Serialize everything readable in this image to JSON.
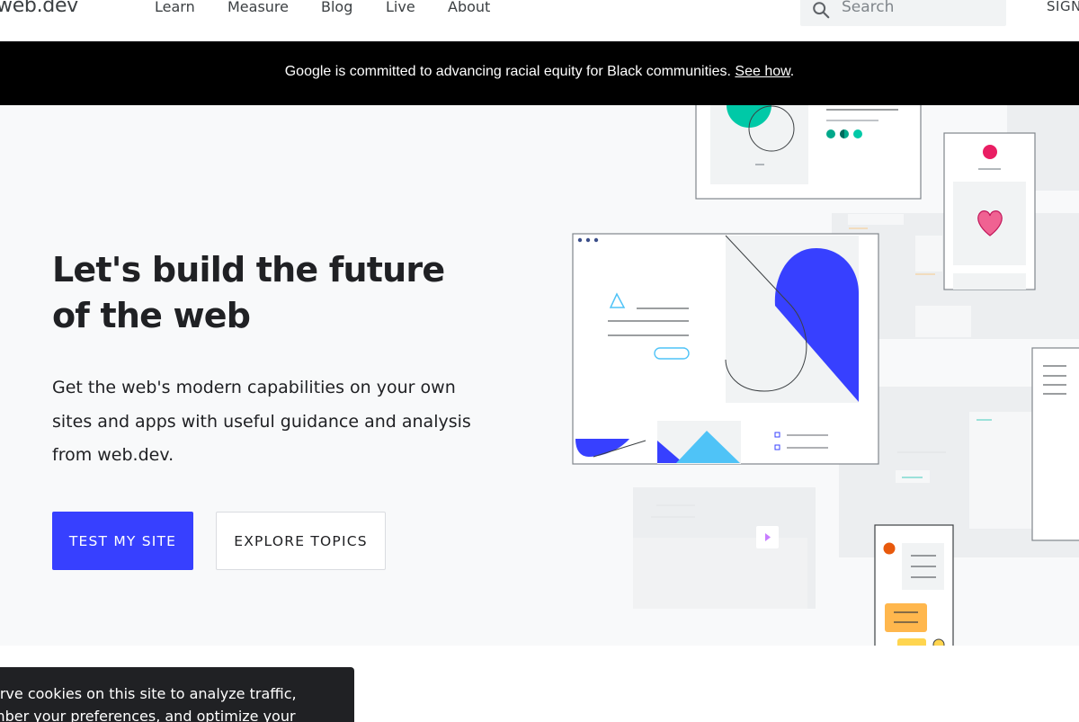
{
  "header": {
    "logo": "web.dev",
    "nav": [
      "Learn",
      "Measure",
      "Blog",
      "Live",
      "About"
    ],
    "search_placeholder": "Search",
    "signin": "SIGN"
  },
  "banner": {
    "text": "Google is committed to advancing racial equity for Black communities. ",
    "link": "See how",
    "end": "."
  },
  "hero": {
    "title": "Let's build the future of the web",
    "subtitle": "Get the web's modern capabilities on your own sites and apps with useful guidance and analysis from web.dev.",
    "primary_button": "TEST MY SITE",
    "secondary_button": "EXPLORE TOPICS"
  },
  "cookie": {
    "line1": "erve cookies on this site to analyze traffic,",
    "line2": "mber your preferences, and optimize your"
  },
  "colors": {
    "accent": "#3740ff",
    "banner_bg": "#000000",
    "hero_bg": "#f8f9fa",
    "teal": "#00c9a7",
    "pink": "#e91e63"
  }
}
